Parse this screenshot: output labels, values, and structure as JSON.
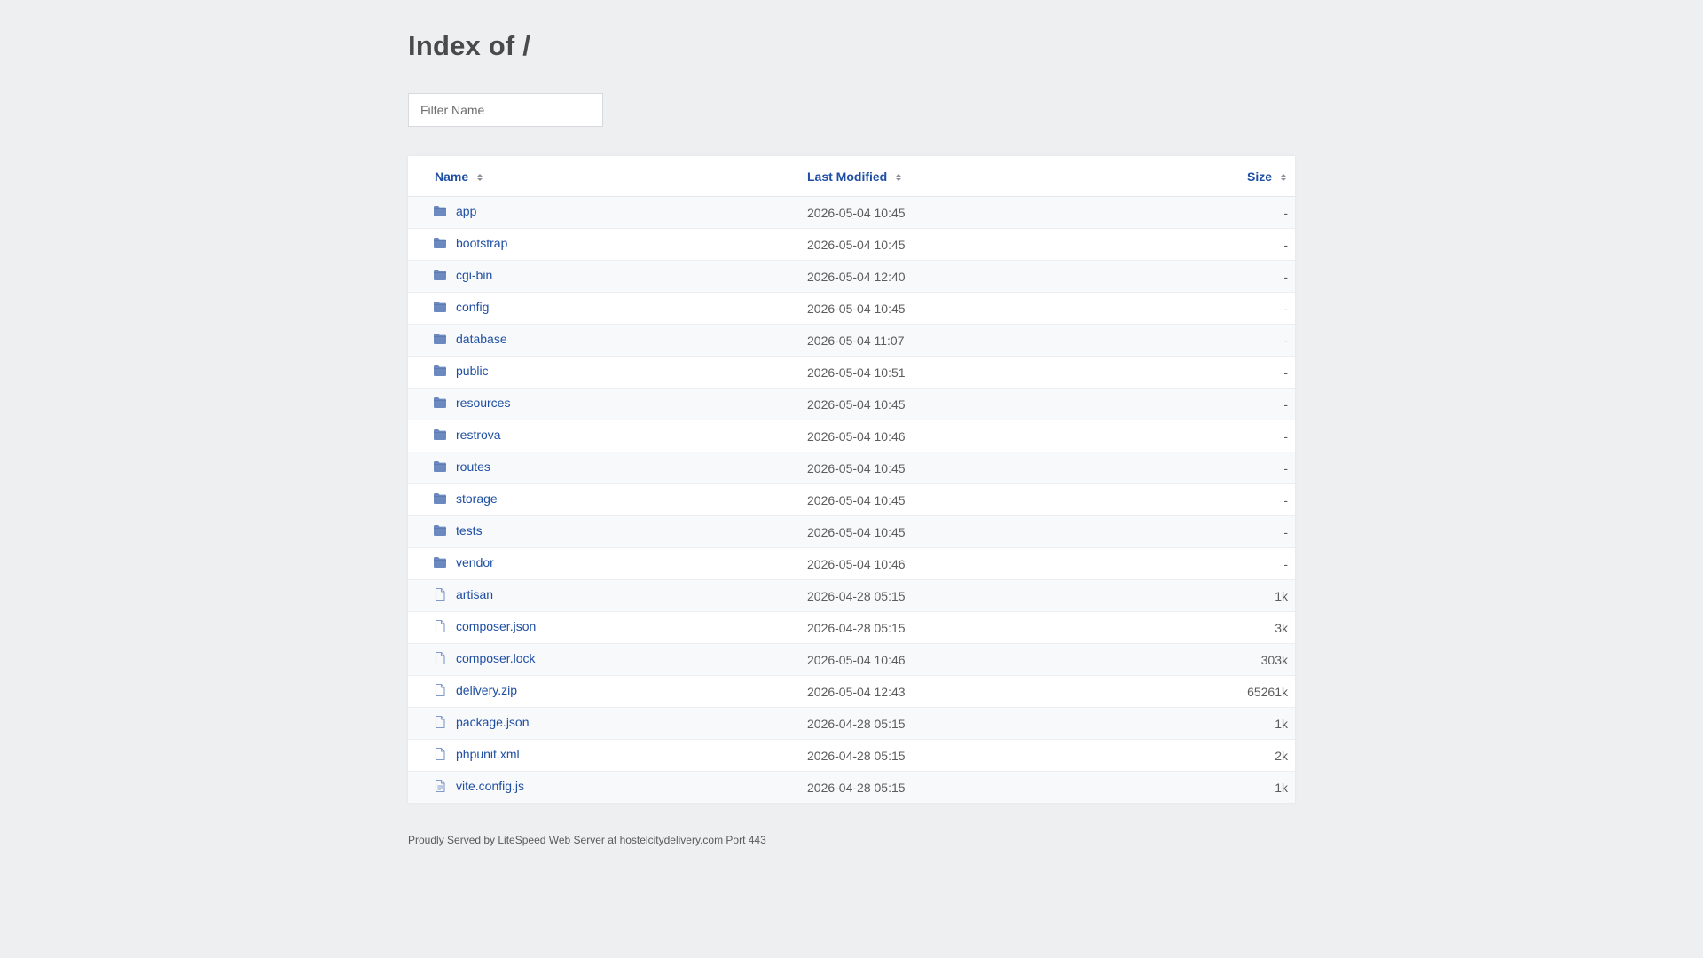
{
  "page": {
    "title": "Index of /",
    "filter_placeholder": "Filter Name"
  },
  "table": {
    "headers": {
      "name": "Name",
      "last_modified": "Last Modified",
      "size": "Size"
    },
    "rows": [
      {
        "name": "app",
        "modified": "2026-05-04 10:45",
        "size": "-",
        "type": "folder"
      },
      {
        "name": "bootstrap",
        "modified": "2026-05-04 10:45",
        "size": "-",
        "type": "folder"
      },
      {
        "name": "cgi-bin",
        "modified": "2026-05-04 12:40",
        "size": "-",
        "type": "folder"
      },
      {
        "name": "config",
        "modified": "2026-05-04 10:45",
        "size": "-",
        "type": "folder"
      },
      {
        "name": "database",
        "modified": "2026-05-04 11:07",
        "size": "-",
        "type": "folder"
      },
      {
        "name": "public",
        "modified": "2026-05-04 10:51",
        "size": "-",
        "type": "folder"
      },
      {
        "name": "resources",
        "modified": "2026-05-04 10:45",
        "size": "-",
        "type": "folder"
      },
      {
        "name": "restrova",
        "modified": "2026-05-04 10:46",
        "size": "-",
        "type": "folder"
      },
      {
        "name": "routes",
        "modified": "2026-05-04 10:45",
        "size": "-",
        "type": "folder"
      },
      {
        "name": "storage",
        "modified": "2026-05-04 10:45",
        "size": "-",
        "type": "folder"
      },
      {
        "name": "tests",
        "modified": "2026-05-04 10:45",
        "size": "-",
        "type": "folder"
      },
      {
        "name": "vendor",
        "modified": "2026-05-04 10:46",
        "size": "-",
        "type": "folder"
      },
      {
        "name": "artisan",
        "modified": "2026-04-28 05:15",
        "size": "1k",
        "type": "file"
      },
      {
        "name": "composer.json",
        "modified": "2026-04-28 05:15",
        "size": "3k",
        "type": "file"
      },
      {
        "name": "composer.lock",
        "modified": "2026-05-04 10:46",
        "size": "303k",
        "type": "file"
      },
      {
        "name": "delivery.zip",
        "modified": "2026-05-04 12:43",
        "size": "65261k",
        "type": "file"
      },
      {
        "name": "package.json",
        "modified": "2026-04-28 05:15",
        "size": "1k",
        "type": "file"
      },
      {
        "name": "phpunit.xml",
        "modified": "2026-04-28 05:15",
        "size": "2k",
        "type": "file"
      },
      {
        "name": "vite.config.js",
        "modified": "2026-04-28 05:15",
        "size": "1k",
        "type": "file-text"
      }
    ]
  },
  "footer": {
    "text": "Proudly Served by LiteSpeed Web Server at hostelcitydelivery.com Port 443"
  },
  "colors": {
    "background": "#eeeff1",
    "link": "#1f4fa3",
    "folder_icon": "#6c8ac0",
    "file_icon": "#7f9acb"
  },
  "icons": {
    "folder": "folder-icon",
    "file": "file-icon",
    "file-text": "file-text-icon",
    "sort": "sort-icon"
  }
}
